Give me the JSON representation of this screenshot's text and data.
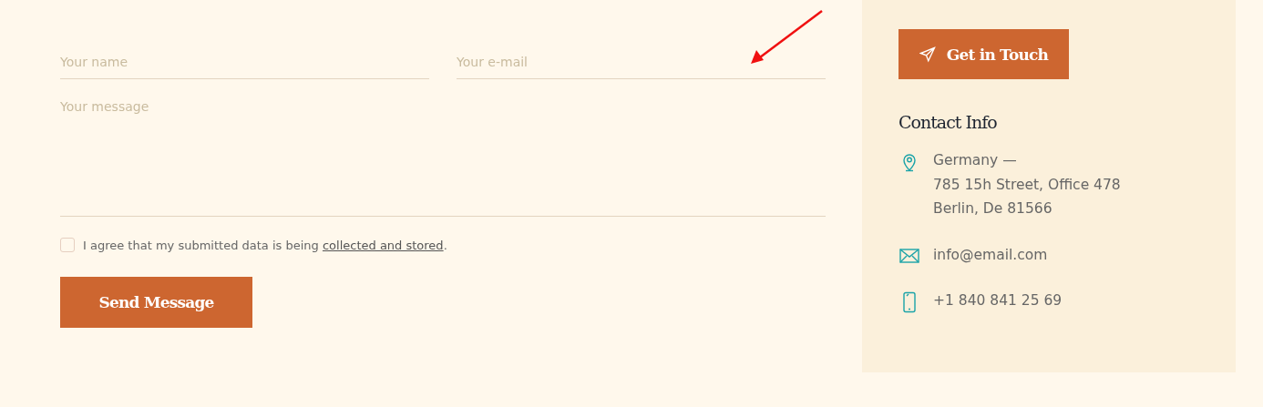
{
  "form": {
    "fields": [
      {
        "placeholder": "Your name"
      },
      {
        "placeholder": "Your e-mail"
      }
    ],
    "message": {
      "placeholder": "Your message"
    },
    "consent": {
      "checked": false,
      "prefix": "I agree that my submitted data is being ",
      "link": "collected and stored",
      "suffix": "."
    },
    "submit": "Send Message"
  },
  "annotation": {
    "kind": "arrow"
  },
  "sidebar": {
    "button": "Get in Touch",
    "heading": "Contact Info",
    "items": [
      {
        "kind": "location",
        "lines": [
          "Germany —",
          "785 15h Street, Office 478",
          "Berlin, De 81566"
        ]
      },
      {
        "kind": "email",
        "lines": [
          "info@email.com"
        ]
      },
      {
        "kind": "phone",
        "lines": [
          "+1 840 841 25 69"
        ]
      }
    ]
  }
}
